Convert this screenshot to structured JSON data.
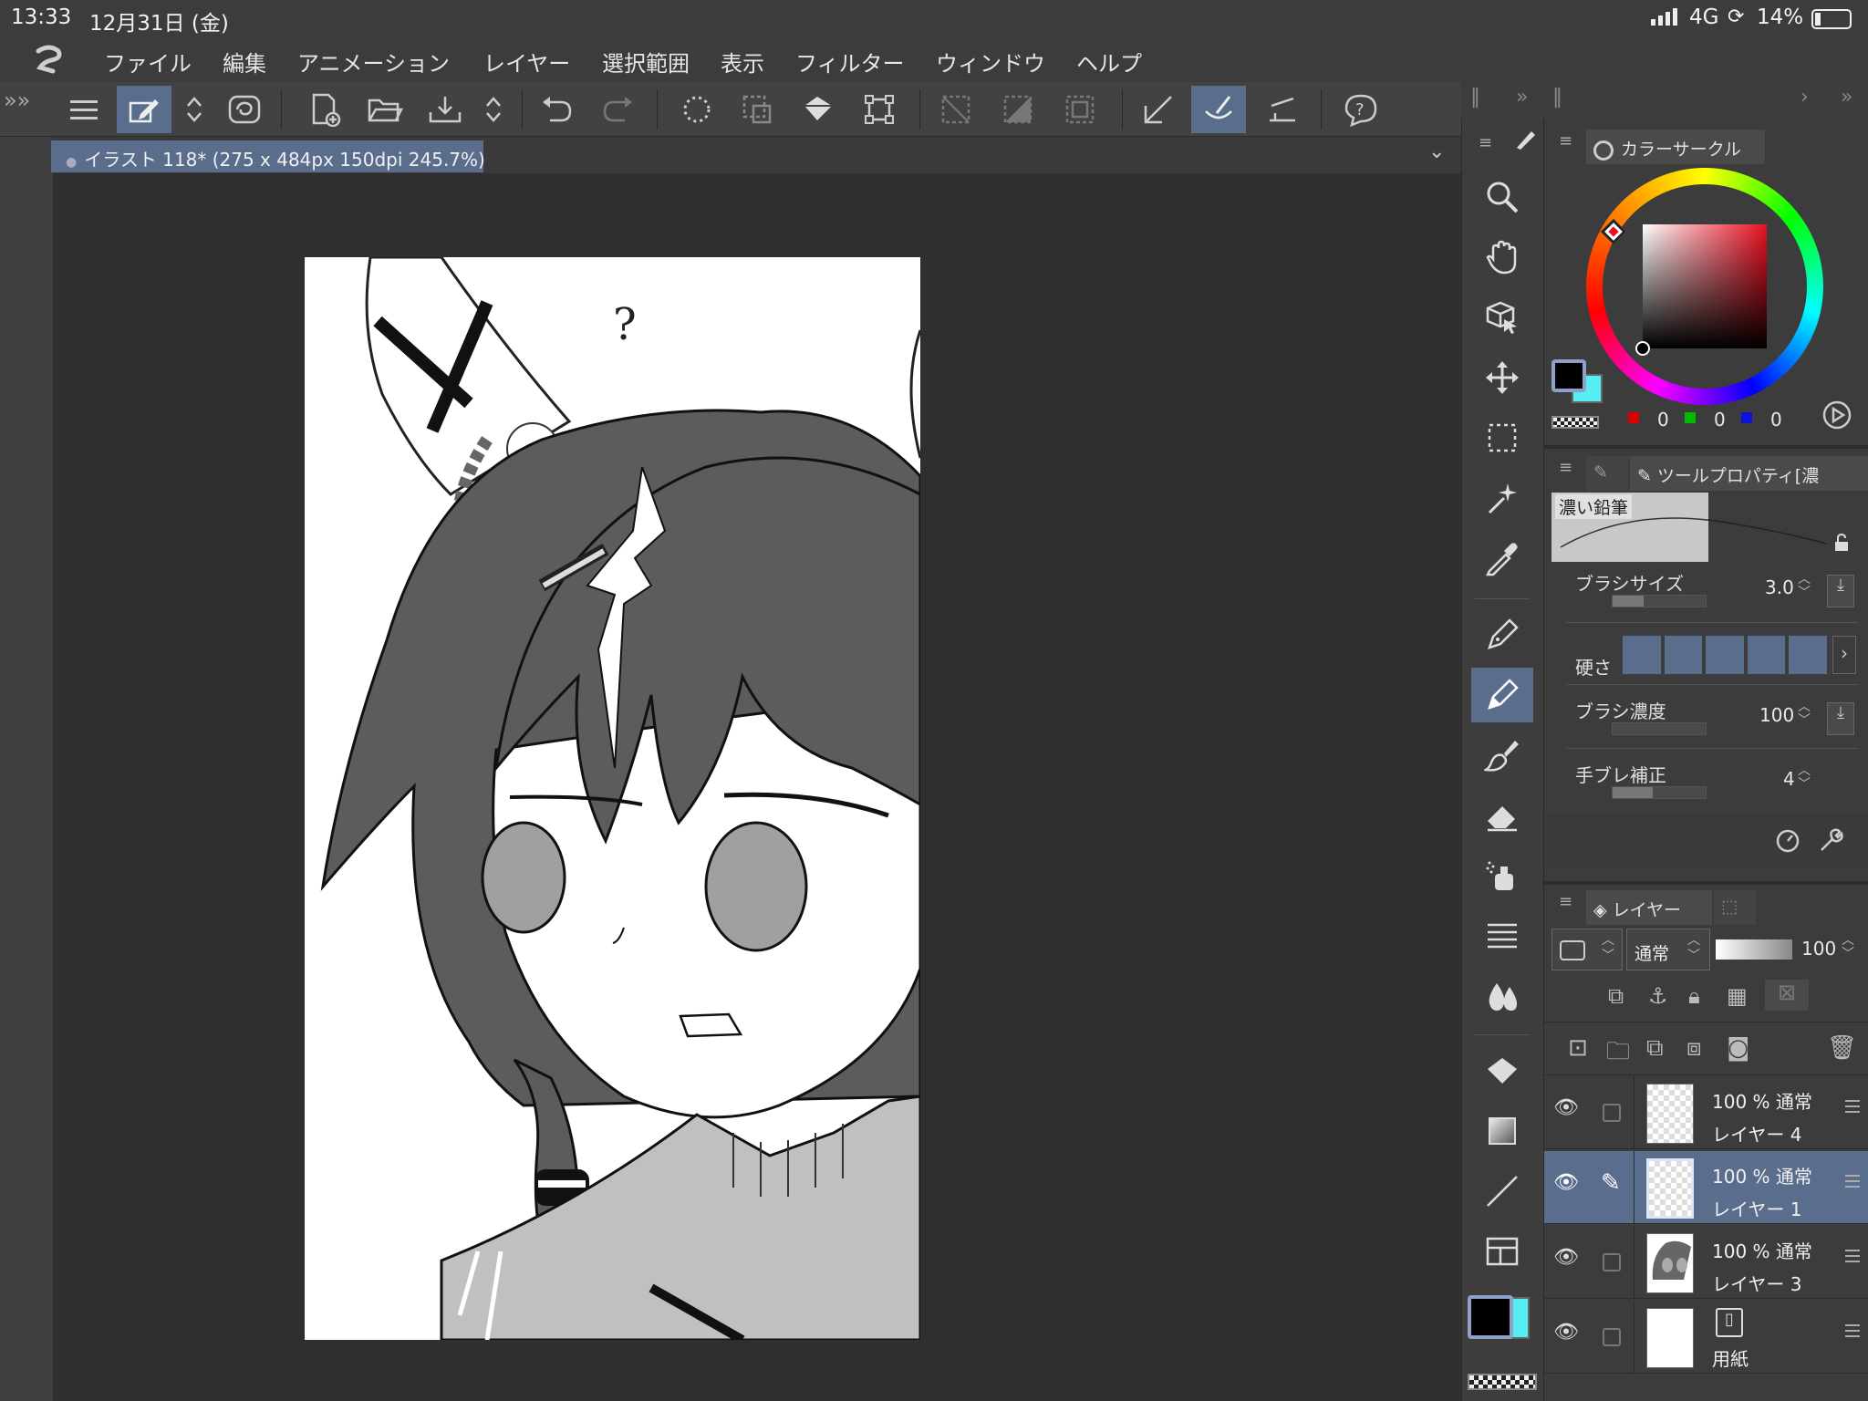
{
  "status": {
    "time": "13:33",
    "date": "12月31日 (金)",
    "network": "4G",
    "battery": "14%"
  },
  "menu": [
    "ファイル",
    "編集",
    "アニメーション",
    "レイヤー",
    "選択範囲",
    "表示",
    "フィルター",
    "ウィンドウ",
    "ヘルプ"
  ],
  "document": {
    "tab_title": "イラスト 118* (275 x 484px 150dpi 245.7%)",
    "canvas_text": "?"
  },
  "color_panel": {
    "tab_label": "カラーサークル",
    "r": "0",
    "g": "0",
    "b": "0",
    "main_color": "#000000",
    "sub_color": "#55eef5"
  },
  "tool_property": {
    "tab_label": "ツールプロパティ[濃",
    "brush_name": "濃い鉛筆",
    "brush_size": {
      "label": "ブラシサイズ",
      "value": "3.0"
    },
    "hardness": {
      "label": "硬さ"
    },
    "density": {
      "label": "ブラシ濃度",
      "value": "100"
    },
    "stabilization": {
      "label": "手ブレ補正",
      "value": "4"
    }
  },
  "layer_panel": {
    "tab_label": "レイヤー",
    "blend_mode": "通常",
    "opacity": "100",
    "layers": [
      {
        "opacity_mode": "100 % 通常",
        "name": "レイヤー 4"
      },
      {
        "opacity_mode": "100 % 通常",
        "name": "レイヤー 1"
      },
      {
        "opacity_mode": "100 % 通常",
        "name": "レイヤー 3"
      },
      {
        "opacity_mode": "",
        "name": "用紙"
      }
    ]
  }
}
